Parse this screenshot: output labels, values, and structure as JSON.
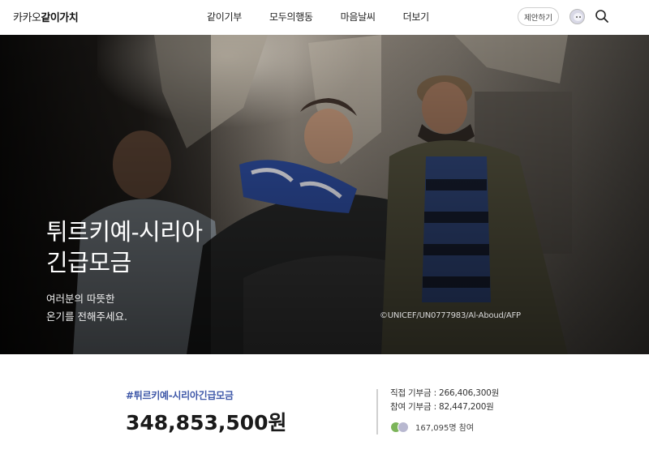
{
  "header": {
    "logo_light": "카카오",
    "logo_bold": "같이가치",
    "nav": [
      "같이기부",
      "모두의행동",
      "마음날씨",
      "더보기"
    ],
    "propose_label": "제안하기",
    "icons": {
      "avatar": "avatar",
      "search": "search-icon"
    }
  },
  "hero": {
    "title_line1": "튀르키예-시리아",
    "title_line2": "긴급모금",
    "subtitle_line1": "여러분의 따뜻한",
    "subtitle_line2": "온기를 전해주세요.",
    "credit": "©UNICEF/UN0777983/Al-Aboud/AFP"
  },
  "campaign": {
    "hashtag": "#튀르키예-시리아긴급모금",
    "total": "348,853,500원",
    "direct": "직접 기부금 : 266,406,300원",
    "participation": "참여 기부금 : 82,447,200원",
    "participants": "167,095명 참여"
  }
}
